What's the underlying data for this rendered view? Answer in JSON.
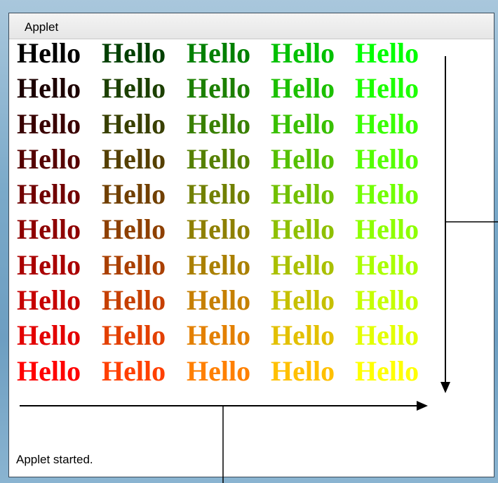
{
  "window": {
    "title": "Applet"
  },
  "grid": {
    "rows": [
      {
        "cells": [
          {
            "text": "Hello",
            "color": "#000000"
          },
          {
            "text": "Hello",
            "color": "#004000"
          },
          {
            "text": "Hello",
            "color": "#008000"
          },
          {
            "text": "Hello",
            "color": "#00c000"
          },
          {
            "text": "Hello",
            "color": "#00ff00"
          }
        ]
      },
      {
        "cells": [
          {
            "text": "Hello",
            "color": "#1c0000"
          },
          {
            "text": "Hello",
            "color": "#1c4000"
          },
          {
            "text": "Hello",
            "color": "#1c8000"
          },
          {
            "text": "Hello",
            "color": "#1cc000"
          },
          {
            "text": "Hello",
            "color": "#1cff00"
          }
        ]
      },
      {
        "cells": [
          {
            "text": "Hello",
            "color": "#390000"
          },
          {
            "text": "Hello",
            "color": "#394000"
          },
          {
            "text": "Hello",
            "color": "#398000"
          },
          {
            "text": "Hello",
            "color": "#39c000"
          },
          {
            "text": "Hello",
            "color": "#39ff00"
          }
        ]
      },
      {
        "cells": [
          {
            "text": "Hello",
            "color": "#550000"
          },
          {
            "text": "Hello",
            "color": "#554000"
          },
          {
            "text": "Hello",
            "color": "#558000"
          },
          {
            "text": "Hello",
            "color": "#55c000"
          },
          {
            "text": "Hello",
            "color": "#55ff00"
          }
        ]
      },
      {
        "cells": [
          {
            "text": "Hello",
            "color": "#710000"
          },
          {
            "text": "Hello",
            "color": "#714000"
          },
          {
            "text": "Hello",
            "color": "#718000"
          },
          {
            "text": "Hello",
            "color": "#71c000"
          },
          {
            "text": "Hello",
            "color": "#71ff00"
          }
        ]
      },
      {
        "cells": [
          {
            "text": "Hello",
            "color": "#8e0000"
          },
          {
            "text": "Hello",
            "color": "#8e4000"
          },
          {
            "text": "Hello",
            "color": "#8e8000"
          },
          {
            "text": "Hello",
            "color": "#8ec000"
          },
          {
            "text": "Hello",
            "color": "#8eff00"
          }
        ]
      },
      {
        "cells": [
          {
            "text": "Hello",
            "color": "#aa0000"
          },
          {
            "text": "Hello",
            "color": "#aa4000"
          },
          {
            "text": "Hello",
            "color": "#aa8000"
          },
          {
            "text": "Hello",
            "color": "#aac000"
          },
          {
            "text": "Hello",
            "color": "#aaff00"
          }
        ]
      },
      {
        "cells": [
          {
            "text": "Hello",
            "color": "#c60000"
          },
          {
            "text": "Hello",
            "color": "#c64000"
          },
          {
            "text": "Hello",
            "color": "#c68000"
          },
          {
            "text": "Hello",
            "color": "#c6c000"
          },
          {
            "text": "Hello",
            "color": "#c6ff00"
          }
        ]
      },
      {
        "cells": [
          {
            "text": "Hello",
            "color": "#e30000"
          },
          {
            "text": "Hello",
            "color": "#e34000"
          },
          {
            "text": "Hello",
            "color": "#e38000"
          },
          {
            "text": "Hello",
            "color": "#e3c000"
          },
          {
            "text": "Hello",
            "color": "#e3ff00"
          }
        ]
      },
      {
        "cells": [
          {
            "text": "Hello",
            "color": "#ff0000"
          },
          {
            "text": "Hello",
            "color": "#ff4000"
          },
          {
            "text": "Hello",
            "color": "#ff8000"
          },
          {
            "text": "Hello",
            "color": "#ffc000"
          },
          {
            "text": "Hello",
            "color": "#ffff00"
          }
        ]
      }
    ]
  },
  "status": {
    "text": "Applet started."
  }
}
